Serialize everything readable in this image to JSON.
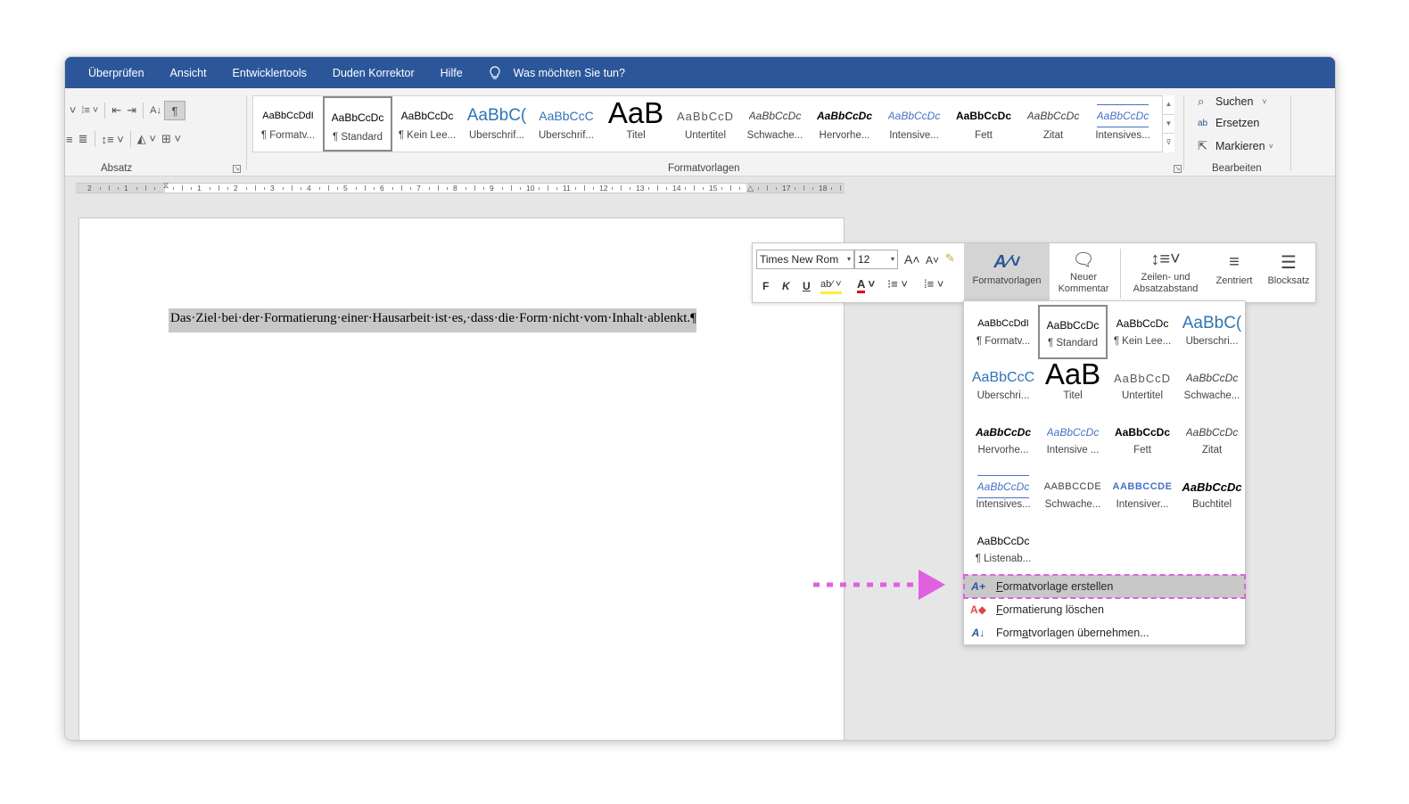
{
  "menubar": {
    "items": [
      "Überprüfen",
      "Ansicht",
      "Entwicklertools",
      "Duden Korrektor",
      "Hilfe"
    ],
    "tell_me": "Was möchten Sie tun?"
  },
  "ribbon": {
    "absatz_label": "Absatz",
    "formatvorlagen_label": "Formatvorlagen",
    "bearbeiten_label": "Bearbeiten",
    "gallery": [
      {
        "preview": "AaBbCcDdI",
        "caption": "¶ Formatv..."
      },
      {
        "preview": "AaBbCcDc",
        "caption": "¶ Standard"
      },
      {
        "preview": "AaBbCcDc",
        "caption": "¶ Kein Lee..."
      },
      {
        "preview": "AaBbC(",
        "caption": "Überschrif..."
      },
      {
        "preview": "AaBbCcC",
        "caption": "Überschrif..."
      },
      {
        "preview": "AaB",
        "caption": "Titel"
      },
      {
        "preview": "AaBbCcD",
        "caption": "Untertitel"
      },
      {
        "preview": "AaBbCcDc",
        "caption": "Schwache..."
      },
      {
        "preview": "AaBbCcDc",
        "caption": "Hervorhe..."
      },
      {
        "preview": "AaBbCcDc",
        "caption": "Intensive..."
      },
      {
        "preview": "AaBbCcDc",
        "caption": "Fett"
      },
      {
        "preview": "AaBbCcDc",
        "caption": "Zitat"
      },
      {
        "preview": "AaBbCcDc",
        "caption": "Intensives..."
      }
    ],
    "bearbeiten": {
      "suchen": "Suchen",
      "ersetzen": "Ersetzen",
      "markieren": "Markieren"
    }
  },
  "document": {
    "text": "Das·Ziel·bei·der·Formatierung·einer·Hausarbeit·ist·es,·dass·die·Form·nicht·vom·Inhalt·ablenkt.¶"
  },
  "minitoolbar": {
    "font": "Times New Rom",
    "size": "12",
    "bold": "F",
    "italic": "K",
    "underline": "U",
    "formatvorlagen": "Formatvorlagen",
    "neuer_kommentar_1": "Neuer",
    "neuer_kommentar_2": "Kommentar",
    "zeilen_1": "Zeilen- und",
    "zeilen_2": "Absatzabstand",
    "zentriert": "Zentriert",
    "blocksatz": "Blocksatz"
  },
  "dropdown": {
    "styles": [
      {
        "preview": "AaBbCcDdI",
        "caption": "¶ Formatv..."
      },
      {
        "preview": "AaBbCcDc",
        "caption": "¶ Standard"
      },
      {
        "preview": "AaBbCcDc",
        "caption": "¶ Kein Lee..."
      },
      {
        "preview": "AaBbC(",
        "caption": "Überschri..."
      },
      {
        "preview": "AaBbCcC",
        "caption": "Überschri..."
      },
      {
        "preview": "AaB",
        "caption": "Titel"
      },
      {
        "preview": "AaBbCcD",
        "caption": "Untertitel"
      },
      {
        "preview": "AaBbCcDc",
        "caption": "Schwache..."
      },
      {
        "preview": "AaBbCcDc",
        "caption": "Hervorhe..."
      },
      {
        "preview": "AaBbCcDc",
        "caption": "Intensive ..."
      },
      {
        "preview": "AaBbCcDc",
        "caption": "Fett"
      },
      {
        "preview": "AaBbCcDc",
        "caption": "Zitat"
      },
      {
        "preview": "AaBbCcDc",
        "caption": "Intensives..."
      },
      {
        "preview": "AABBCCDE",
        "caption": "Schwache..."
      },
      {
        "preview": "AABBCCDE",
        "caption": "Intensiver..."
      },
      {
        "preview": "AaBbCcDc",
        "caption": "Buchtitel"
      },
      {
        "preview": "AaBbCcDc",
        "caption": "¶ Listenab..."
      }
    ],
    "create_pre": "",
    "create_u": "F",
    "create_post": "ormatvorlage erstellen",
    "clear_u": "F",
    "clear_post": "ormatierung löschen",
    "apply_pre": "Form",
    "apply_u": "a",
    "apply_post": "tvorlagen übernehmen..."
  },
  "colors": {
    "titlebar": "#2b579a",
    "highlight_arrow": "#e060e0",
    "heading_blue": "#2e74b5"
  }
}
